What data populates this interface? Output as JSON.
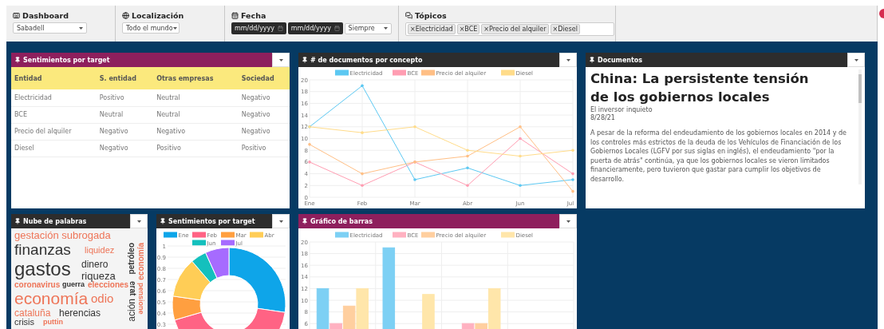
{
  "filters": [
    {
      "kind": "select",
      "label": "Dashboard",
      "value": "Sabadell"
    },
    {
      "kind": "select",
      "label": "Localización",
      "value": "Todo el mundo"
    },
    {
      "kind": "dates",
      "label": "Fecha",
      "dates": [
        "mm/dd/yyyy",
        "mm/dd/yyyy"
      ],
      "value": "Siempre"
    },
    {
      "kind": "tags",
      "label": "Tópicos",
      "tags": [
        {
          "remove": "×",
          "label": "Electricidad"
        },
        {
          "remove": "×",
          "label": "BCE"
        },
        {
          "remove": "×",
          "label": "Precio del alquiler"
        },
        {
          "remove": "×",
          "label": "Diesel"
        }
      ]
    }
  ],
  "panels": [
    {
      "kind": "table",
      "title": "Sentimientos por target",
      "color": "#8e1f5d",
      "columns": [
        "Entidad",
        "S. entidad",
        "Otras empresas",
        "Sociedad"
      ],
      "rows": [
        [
          "Electricidad",
          "Positivo",
          "Neutral",
          "Negativo"
        ],
        [
          "BCE",
          "Neutral",
          "Neutral",
          "Negativo"
        ],
        [
          "Precio del alquiler",
          "Negativo",
          "Negativo",
          "Negativo"
        ],
        [
          "Diesel",
          "Negativo",
          "Positivo",
          "Positivo"
        ]
      ]
    },
    {
      "kind": "chart",
      "title": "# de documentos por concepto",
      "color": "#2d2d2d",
      "chart_data": {
        "type": "line",
        "categories": [
          "Ene",
          "Feb",
          "Mar",
          "Abr",
          "Jun",
          "Jul"
        ],
        "ylim": [
          0,
          20
        ],
        "yticks": [
          0,
          2,
          4,
          6,
          8,
          10,
          12,
          14,
          16,
          18,
          20
        ],
        "grid": true,
        "legend": true,
        "series": [
          {
            "name": "Electricidad",
            "color": "#5cc8f2",
            "values": [
              12,
              19,
              3,
              5,
              2,
              3
            ]
          },
          {
            "name": "BCE",
            "color": "#ff9db2",
            "values": [
              6,
              2,
              6,
              2,
              10,
              4
            ]
          },
          {
            "name": "Precio del alquiler",
            "color": "#ffbf85",
            "values": [
              9,
              4,
              6,
              7,
              12,
              1
            ]
          },
          {
            "name": "Diesel",
            "color": "#ffdc8a",
            "values": [
              12,
              11,
              12,
              8,
              7,
              8
            ]
          }
        ]
      }
    },
    {
      "kind": "document",
      "title": "Documentos",
      "color": "#2d2d2d",
      "headline": "China: La persistente tensión de los gobiernos locales",
      "source": "El inversor inquieto",
      "date": "8/28/21",
      "body": "A pesar de la reforma del endeudamiento de los gobiernos locales en 2014 y de los controles más estrictos de la deuda de los Vehículos de Financiación de los Gobiernos Locales (LGFV por sus siglas en inglés), el endeudamiento \"por la puerta de atrás\" continúa, ya que los gobiernos locales se vieron limitados financieramente, pero tuvieron que gastar para cumplir los objetivos de desarrollo."
    },
    {
      "kind": "cloud",
      "title": "Nube de palabras",
      "color": "#2d2d2d",
      "words": [
        {
          "text": "gestación subrogada",
          "color": "#ee7558"
        },
        {
          "text": "finanzas",
          "color": "#333333"
        },
        {
          "text": "liquidez",
          "color": "#ee7558"
        },
        {
          "text": "petróleo",
          "color": "#333333"
        },
        {
          "text": "economía",
          "color": "#ee7558"
        },
        {
          "text": "gastos",
          "color": "#333333"
        },
        {
          "text": "dinero",
          "color": "#333333"
        },
        {
          "text": "riqueza",
          "color": "#333333"
        },
        {
          "text": "coronavirus",
          "color": "#ee7558"
        },
        {
          "text": "guerra",
          "color": "#333333"
        },
        {
          "text": "elecciones",
          "color": "#ee7558"
        },
        {
          "text": "erat",
          "color": "#333333"
        },
        {
          "text": "pensione",
          "color": "#ee7558"
        },
        {
          "text": "economía",
          "color": "#ee7558"
        },
        {
          "text": "odio",
          "color": "#ee7558"
        },
        {
          "text": "ación",
          "color": "#333333"
        },
        {
          "text": "cataluña",
          "color": "#ee7558"
        },
        {
          "text": "herencias",
          "color": "#333333"
        },
        {
          "text": "crisis",
          "color": "#333333"
        },
        {
          "text": "puttin",
          "color": "#ee7558"
        }
      ]
    },
    {
      "kind": "chart",
      "title": "Sentimientos por target",
      "color": "#2d2d2d",
      "axis_labels": [
        "1",
        "0.9",
        "0.8",
        "0.7",
        "0.6",
        "0.5",
        "0.4",
        "0.3"
      ],
      "chart_data": {
        "type": "donut",
        "legend": true,
        "categories": [
          "Ene",
          "Feb",
          "Mar",
          "Abr",
          "Jun",
          "Jul"
        ],
        "values": [
          27.3,
          43.2,
          6.8,
          11.4,
          4.5,
          6.8
        ],
        "colors": [
          "#0ea5e9",
          "#ff6384",
          "#ff9f40",
          "#ffcd56",
          "#14c0bd",
          "#a66bff"
        ]
      }
    },
    {
      "kind": "chart",
      "title": "Gráfico de barras",
      "color": "#8e1f5d",
      "chart_data": {
        "type": "bar",
        "ylim": [
          0,
          20
        ],
        "yticks": [
          6,
          8,
          10,
          12,
          14,
          16,
          18,
          20
        ],
        "grid": true,
        "legend": true,
        "series": [
          {
            "name": "Electricidad",
            "color": "#7dd0f4",
            "values": [
              12,
              19,
              null,
              null
            ]
          },
          {
            "name": "BCE",
            "color": "#ffb1c1",
            "values": [
              6,
              null,
              6,
              null
            ]
          },
          {
            "name": "Precio del alquiler",
            "color": "#ffcf9f",
            "values": [
              9,
              null,
              6,
              null
            ]
          },
          {
            "name": "Diesel",
            "color": "#ffe6aa",
            "values": [
              12,
              11,
              12,
              null
            ]
          }
        ]
      }
    }
  ]
}
